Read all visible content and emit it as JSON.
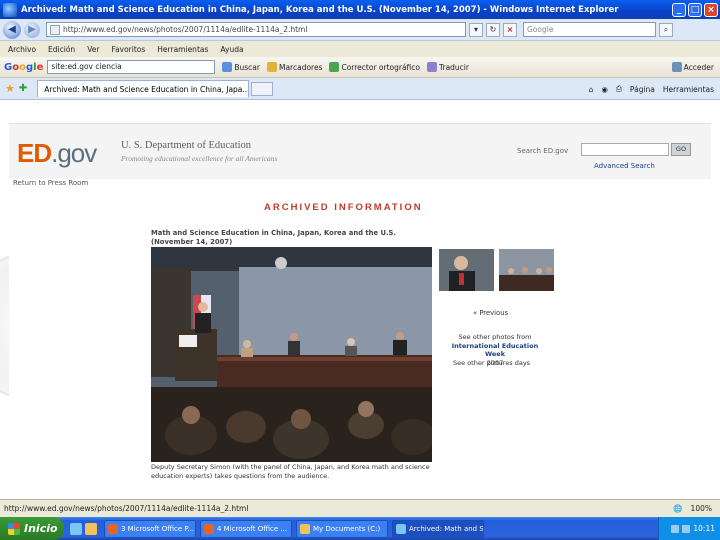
{
  "window": {
    "title": "Archived: Math and Science Education in China, Japan, Korea and the U.S. (November 14, 2007) - Windows Internet Explorer"
  },
  "addressbar": {
    "url": "http://www.ed.gov/news/photos/2007/1114a/edlite-1114a_2.html",
    "search_placeholder": "Google"
  },
  "menu": [
    "Archivo",
    "Edición",
    "Ver",
    "Favoritos",
    "Herramientas",
    "Ayuda"
  ],
  "google_toolbar": {
    "logo": "Google",
    "query": "site:ed.gov ciencia",
    "items": [
      "Buscar",
      "Marcadores",
      "Corrector ortográfico",
      "Traducir",
      "Acceder"
    ]
  },
  "tab": {
    "title": "Archived: Math and Science Education in China, Japa..."
  },
  "tab_tools": [
    "Página",
    "Herramientas"
  ],
  "page": {
    "logo_ed": "ED",
    "logo_gov": ".gov",
    "department": "U. S. Department of Education",
    "tagline": "Promoting educational excellence for all Americans",
    "search_label": "Search ED.gov",
    "search_go": "GO",
    "advanced_search": "Advanced Search",
    "return_link": "Return to Press Room",
    "archived_banner": "ARCHIVED INFORMATION",
    "article_title": "Math and Science Education in China, Japan, Korea and the U.S. (November 14, 2007)",
    "previous": "« Previous",
    "see_other": "See other photos from",
    "see_other_event": "International Education Week",
    "see_other_year": "2007",
    "see_all": "See other pictures days",
    "caption": "Deputy Secretary Simon (with the panel of China, Japan, and Korea math and science education experts) takes questions from the audience."
  },
  "status": {
    "url": "http://www.ed.gov/news/photos/2007/1114a/edlite-1114a_2.html",
    "zoom": "100%"
  },
  "taskbar": {
    "start": "Inicio",
    "tasks": [
      "3 Microsoft Office P...",
      "4 Microsoft Office ...",
      "My Documents (C:)",
      "Archived: Math and S..."
    ],
    "clock": "10:11"
  }
}
